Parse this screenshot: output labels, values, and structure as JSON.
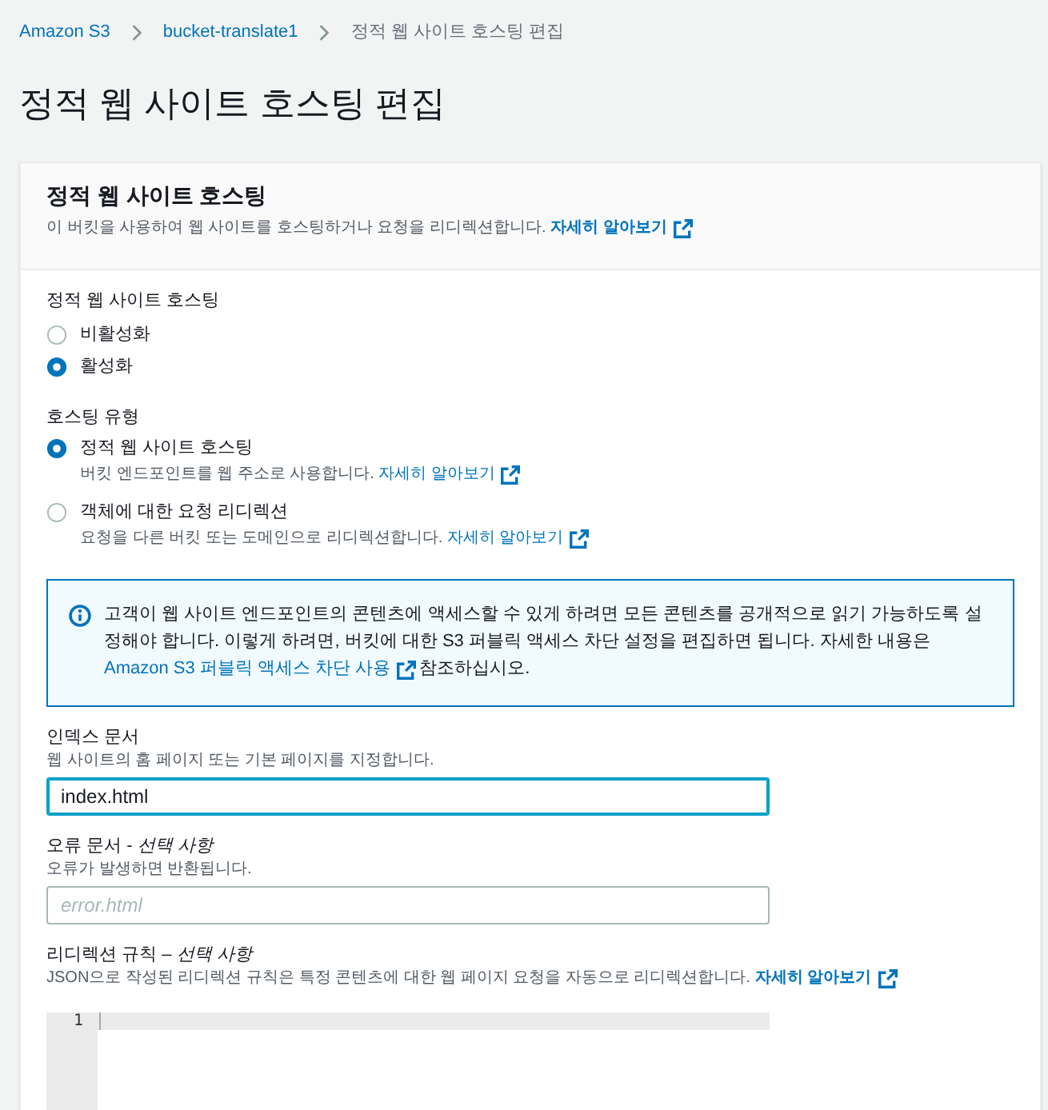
{
  "breadcrumbs": [
    {
      "label": "Amazon S3",
      "link": true
    },
    {
      "label": "bucket-translate1",
      "link": true
    },
    {
      "label": "정적 웹 사이트 호스팅 편집",
      "link": false
    }
  ],
  "page_title": "정적 웹 사이트 호스팅 편집",
  "panel": {
    "title": "정적 웹 사이트 호스팅",
    "description": "이 버킷을 사용하여 웹 사이트를 호스팅하거나 요청을 리디렉션합니다.",
    "learn_more": "자세히 알아보기"
  },
  "hosting": {
    "label": "정적 웹 사이트 호스팅",
    "options": [
      {
        "label": "비활성화",
        "selected": false
      },
      {
        "label": "활성화",
        "selected": true
      }
    ]
  },
  "hosting_type": {
    "label": "호스팅 유형",
    "options": [
      {
        "label": "정적 웹 사이트 호스팅",
        "description": "버킷 엔드포인트를 웹 주소로 사용합니다.",
        "learn_more": "자세히 알아보기",
        "selected": true
      },
      {
        "label": "객체에 대한 요청 리디렉션",
        "description": "요청을 다른 버킷 또는 도메인으로 리디렉션합니다.",
        "learn_more": "자세히 알아보기",
        "selected": false
      }
    ]
  },
  "info_alert": {
    "text": "고객이 웹 사이트 엔드포인트의 콘텐츠에 액세스할 수 있게 하려면 모든 콘텐츠를 공개적으로 읽기 가능하도록 설정해야 합니다. 이렇게 하려면, 버킷에 대한 S3 퍼블릭 액세스 차단 설정을 편집하면 됩니다. 자세한 내용은",
    "link": "Amazon S3 퍼블릭 액세스 차단 사용",
    "text_after": "참조하십시오."
  },
  "index_document": {
    "label": "인덱스 문서",
    "description": "웹 사이트의 홈 페이지 또는 기본 페이지를 지정합니다.",
    "value": "index.html",
    "focused": true
  },
  "error_document": {
    "label": "오류 문서 - *선택 사항*",
    "description": "오류가 발생하면 반환됩니다.",
    "placeholder": "error.html",
    "focused": false
  },
  "redirection_rules": {
    "label": "리디렉션 규칙 – *선택 사항*",
    "description": "JSON으로 작성된 리디렉션 규칙은 특정 콘텐츠에 대한 웹 페이지 요청을 자동으로 리디렉션합니다.",
    "learn_more": "자세히 알아보기",
    "editor": {
      "line_numbers": [
        "1"
      ]
    }
  }
}
